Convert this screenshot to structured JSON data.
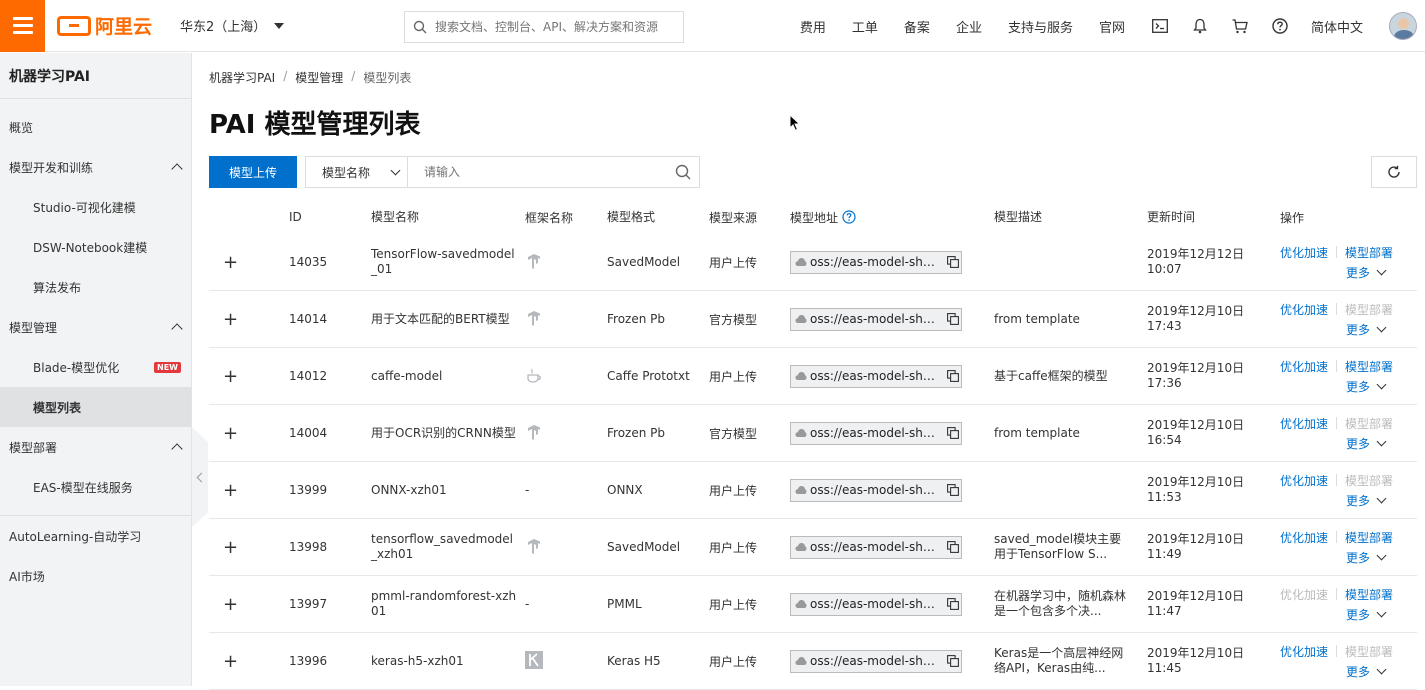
{
  "topbar": {
    "logo_text": "阿里云",
    "region": "华东2（上海）",
    "search_placeholder": "搜索文档、控制台、API、解决方案和资源",
    "nav": [
      "费用",
      "工单",
      "备案",
      "企业",
      "支持与服务",
      "官网"
    ],
    "language": "简体中文",
    "icons": [
      "terminal-icon",
      "bell-icon",
      "cart-icon",
      "help-icon"
    ]
  },
  "sidebar": {
    "title": "机器学习PAI",
    "items": [
      {
        "label": "概览",
        "level": 0
      },
      {
        "label": "模型开发和训练",
        "level": 0,
        "expanded": true
      },
      {
        "label": "Studio-可视化建模",
        "level": 1
      },
      {
        "label": "DSW-Notebook建模",
        "level": 1
      },
      {
        "label": "算法发布",
        "level": 1
      },
      {
        "label": "模型管理",
        "level": 0,
        "expanded": true
      },
      {
        "label": "Blade-模型优化",
        "level": 1,
        "badge": "NEW"
      },
      {
        "label": "模型列表",
        "level": 1,
        "active": true
      },
      {
        "label": "模型部署",
        "level": 0,
        "expanded": true
      },
      {
        "label": "EAS-模型在线服务",
        "level": 1
      },
      {
        "label": "AutoLearning-自动学习",
        "level": 0
      },
      {
        "label": "AI市场",
        "level": 0
      }
    ]
  },
  "breadcrumb": [
    "机器学习PAI",
    "模型管理",
    "模型列表"
  ],
  "page_title": "PAI 模型管理列表",
  "toolbar": {
    "upload_label": "模型上传",
    "filter_select": "模型名称",
    "filter_placeholder": "请输入"
  },
  "table": {
    "headers": [
      "ID",
      "模型名称",
      "框架名称",
      "模型格式",
      "模型来源",
      "模型地址",
      "模型描述",
      "更新时间",
      "操作"
    ],
    "rows": [
      {
        "id": "14035",
        "name": "TensorFlow-savedmodel_01",
        "framework": "tensorflow-icon",
        "format": "SavedModel",
        "source": "用户上传",
        "addr": "oss://eas-model-shan...",
        "desc": "",
        "time": "2019年12月12日 10:07",
        "optimize_enabled": true,
        "deploy_enabled": true
      },
      {
        "id": "14014",
        "name": "用于文本匹配的BERT模型",
        "framework": "tensorflow-icon",
        "format": "Frozen Pb",
        "source": "官方模型",
        "addr": "oss://eas-model-shan...",
        "desc": "from template",
        "time": "2019年12月10日 17:43",
        "optimize_enabled": true,
        "deploy_enabled": false
      },
      {
        "id": "14012",
        "name": "caffe-model",
        "framework": "caffe-icon",
        "format": "Caffe Prototxt",
        "source": "用户上传",
        "addr": "oss://eas-model-shan...",
        "desc": "基于caffe框架的模型",
        "time": "2019年12月10日 17:36",
        "optimize_enabled": true,
        "deploy_enabled": true
      },
      {
        "id": "14004",
        "name": "用于OCR识别的CRNN模型",
        "framework": "tensorflow-icon",
        "format": "Frozen Pb",
        "source": "官方模型",
        "addr": "oss://eas-model-shan...",
        "desc": "from template",
        "time": "2019年12月10日 16:54",
        "optimize_enabled": true,
        "deploy_enabled": false
      },
      {
        "id": "13999",
        "name": "ONNX-xzh01",
        "framework": "-",
        "format": "ONNX",
        "source": "用户上传",
        "addr": "oss://eas-model-shan...",
        "desc": "",
        "time": "2019年12月10日 11:53",
        "optimize_enabled": true,
        "deploy_enabled": false
      },
      {
        "id": "13998",
        "name": "tensorflow_savedmodel_xzh01",
        "framework": "tensorflow-icon",
        "format": "SavedModel",
        "source": "用户上传",
        "addr": "oss://eas-model-shan...",
        "desc": "saved_model模块主要用于TensorFlow S...",
        "time": "2019年12月10日 11:49",
        "optimize_enabled": true,
        "deploy_enabled": true
      },
      {
        "id": "13997",
        "name": "pmml-randomforest-xzh01",
        "framework": "-",
        "format": "PMML",
        "source": "用户上传",
        "addr": "oss://eas-model-shan...",
        "desc": "在机器学习中，随机森林是一个包含多个决...",
        "time": "2019年12月10日 11:47",
        "optimize_enabled": false,
        "deploy_enabled": true
      },
      {
        "id": "13996",
        "name": "keras-h5-xzh01",
        "framework": "keras-icon",
        "format": "Keras H5",
        "source": "用户上传",
        "addr": "oss://eas-model-shan...",
        "desc": "Keras是一个高层神经网络API，Keras由纯...",
        "time": "2019年12月10日 11:45",
        "optimize_enabled": true,
        "deploy_enabled": false
      }
    ],
    "op_optimize": "优化加速",
    "op_deploy": "模型部署",
    "op_more": "更多"
  },
  "colors": {
    "accent": "#0070cc",
    "brand": "#ff6a00",
    "badge": "#e4393c"
  }
}
